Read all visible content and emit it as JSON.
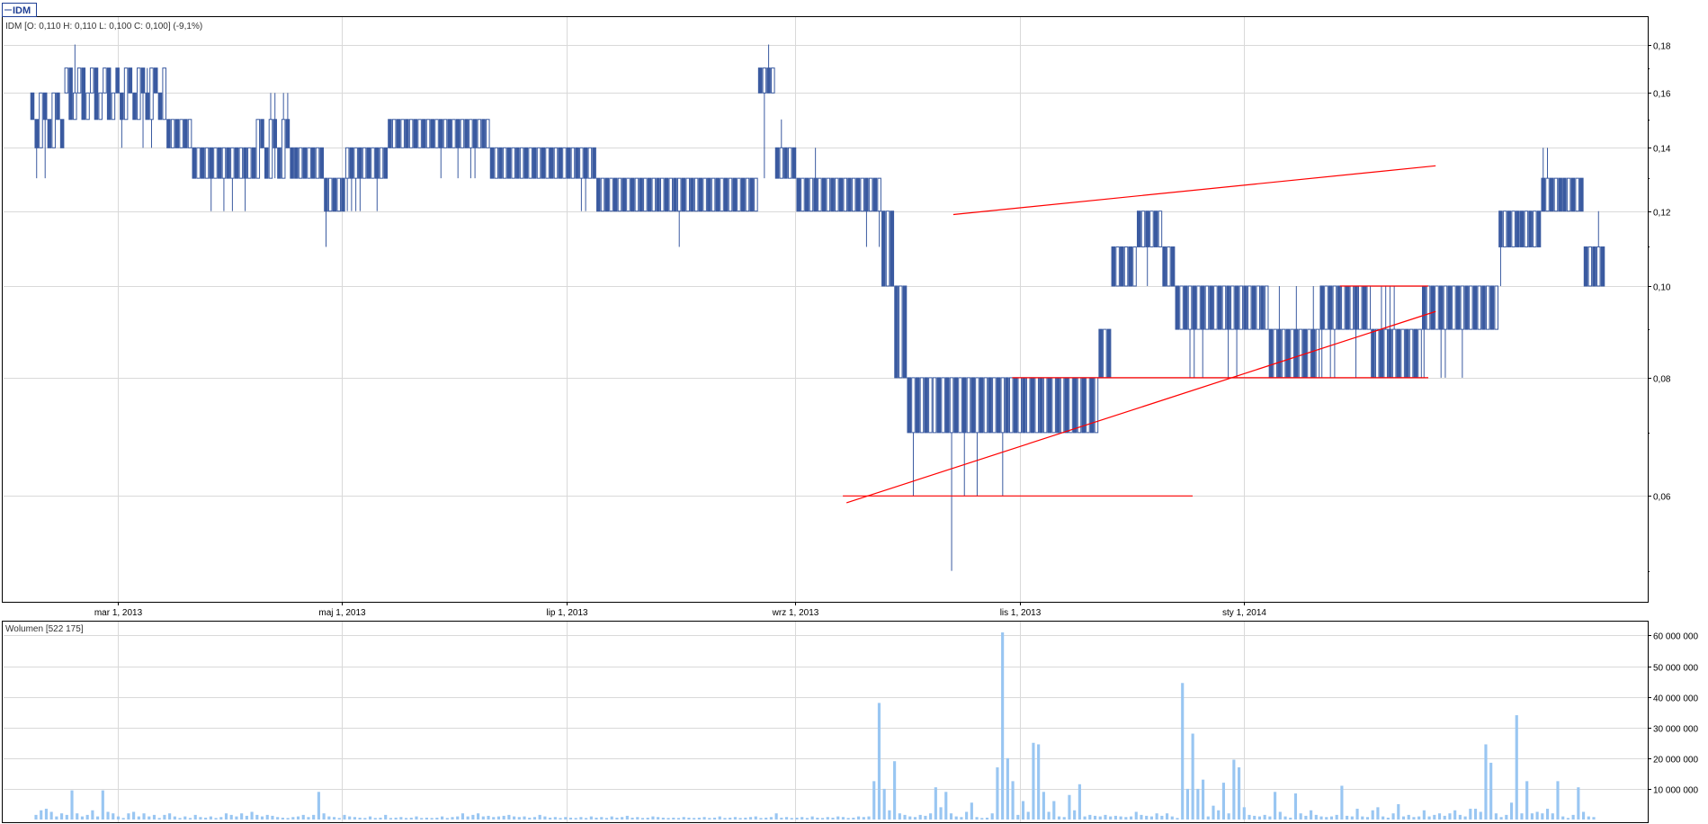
{
  "legend": {
    "symbol_label": "IDM"
  },
  "price_header": "IDM [O: 0,110  H: 0,110  L: 0,100  C: 0,100] (-9,1%)",
  "volume_header": "Wolumen [522 175]",
  "colors": {
    "bar": "#3a5aa0",
    "volume": "#99c6f2",
    "grid": "#d9d9d9",
    "frame": "#000000",
    "trendline": "#ff0000"
  },
  "chart_data": [
    {
      "type": "candlestick",
      "title": "",
      "x_tick_labels": [
        "mar 1, 2013",
        "maj 1, 2013",
        "lip 1, 2013",
        "wrz 1, 2013",
        "lis 1, 2013",
        "sty 1, 2014"
      ],
      "y_tick_labels": [
        "0,18",
        "0,16",
        "0,14",
        "0,12",
        "0,10",
        "0,08",
        "0,06"
      ],
      "y_scale": "log",
      "ylim": [
        0.0475,
        0.185
      ],
      "grid": true,
      "candle_stats": {
        "open": 0.11,
        "high": 0.11,
        "low": 0.1,
        "close": 0.1,
        "change": "-9,1%"
      },
      "segments": [
        {
          "bars": 8,
          "levels": [
            0.16,
            0.15,
            0.14
          ],
          "low_min": 0.13,
          "high_max": 0.16
        },
        {
          "bars": 12,
          "levels": [
            0.16,
            0.17,
            0.15
          ],
          "low_min": 0.15,
          "high_max": 0.18
        },
        {
          "bars": 12,
          "levels": [
            0.17,
            0.16,
            0.15
          ],
          "low_min": 0.14,
          "high_max": 0.17
        },
        {
          "bars": 6,
          "levels": [
            0.15,
            0.14
          ],
          "low_min": 0.14,
          "high_max": 0.15
        },
        {
          "bars": 14,
          "levels": [
            0.14,
            0.13
          ],
          "low_min": 0.12,
          "high_max": 0.14
        },
        {
          "bars": 10,
          "levels": [
            0.14,
            0.13,
            0.15
          ],
          "low_min": 0.13,
          "high_max": 0.16
        },
        {
          "bars": 7,
          "levels": [
            0.14,
            0.13
          ],
          "low_min": 0.13,
          "high_max": 0.14
        },
        {
          "bars": 5,
          "levels": [
            0.13,
            0.12
          ],
          "low_min": 0.11,
          "high_max": 0.13
        },
        {
          "bars": 10,
          "levels": [
            0.13,
            0.14
          ],
          "low_min": 0.12,
          "high_max": 0.14
        },
        {
          "bars": 14,
          "levels": [
            0.15,
            0.14
          ],
          "low_min": 0.13,
          "high_max": 0.15
        },
        {
          "bars": 10,
          "levels": [
            0.15,
            0.14
          ],
          "low_min": 0.13,
          "high_max": 0.15
        },
        {
          "bars": 14,
          "levels": [
            0.14,
            0.13
          ],
          "low_min": 0.13,
          "high_max": 0.14
        },
        {
          "bars": 11,
          "levels": [
            0.14,
            0.13
          ],
          "low_min": 0.12,
          "high_max": 0.14
        },
        {
          "bars": 14,
          "levels": [
            0.13,
            0.12
          ],
          "low_min": 0.12,
          "high_max": 0.13
        },
        {
          "bars": 12,
          "levels": [
            0.13,
            0.12
          ],
          "low_min": 0.11,
          "high_max": 0.13
        },
        {
          "bars": 12,
          "levels": [
            0.13,
            0.12
          ],
          "low_min": 0.12,
          "high_max": 0.13
        },
        {
          "bars": 4,
          "levels": [
            0.17,
            0.16
          ],
          "low_min": 0.13,
          "high_max": 0.18
        },
        {
          "bars": 5,
          "levels": [
            0.14,
            0.13
          ],
          "low_min": 0.13,
          "high_max": 0.15
        },
        {
          "bars": 12,
          "levels": [
            0.13,
            0.12
          ],
          "low_min": 0.12,
          "high_max": 0.14
        },
        {
          "bars": 8,
          "levels": [
            0.13,
            0.12
          ],
          "low_min": 0.11,
          "high_max": 0.13
        },
        {
          "bars": 3,
          "levels": [
            0.12,
            0.1
          ],
          "low_min": 0.1,
          "high_max": 0.12
        },
        {
          "bars": 3,
          "levels": [
            0.1,
            0.08
          ],
          "low_min": 0.08,
          "high_max": 0.1
        },
        {
          "bars": 6,
          "levels": [
            0.08,
            0.07
          ],
          "low_min": 0.06,
          "high_max": 0.08
        },
        {
          "bars": 5,
          "levels": [
            0.07,
            0.08
          ],
          "low_min": 0.05,
          "high_max": 0.08
        },
        {
          "bars": 12,
          "levels": [
            0.08,
            0.07
          ],
          "low_min": 0.06,
          "high_max": 0.08
        },
        {
          "bars": 16,
          "levels": [
            0.08,
            0.07
          ],
          "low_min": 0.07,
          "high_max": 0.08
        },
        {
          "bars": 6,
          "levels": [
            0.08,
            0.07
          ],
          "low_min": 0.07,
          "high_max": 0.08
        },
        {
          "bars": 3,
          "levels": [
            0.09,
            0.08
          ],
          "low_min": 0.08,
          "high_max": 0.09
        },
        {
          "bars": 6,
          "levels": [
            0.11,
            0.1
          ],
          "low_min": 0.09,
          "high_max": 0.11
        },
        {
          "bars": 6,
          "levels": [
            0.12,
            0.11
          ],
          "low_min": 0.1,
          "high_max": 0.12
        },
        {
          "bars": 3,
          "levels": [
            0.11,
            0.1
          ],
          "low_min": 0.1,
          "high_max": 0.11
        },
        {
          "bars": 10,
          "levels": [
            0.1,
            0.09
          ],
          "low_min": 0.08,
          "high_max": 0.1
        },
        {
          "bars": 12,
          "levels": [
            0.1,
            0.09
          ],
          "low_min": 0.08,
          "high_max": 0.1
        },
        {
          "bars": 12,
          "levels": [
            0.09,
            0.08
          ],
          "low_min": 0.08,
          "high_max": 0.1
        },
        {
          "bars": 12,
          "levels": [
            0.1,
            0.09
          ],
          "low_min": 0.08,
          "high_max": 0.1
        },
        {
          "bars": 12,
          "levels": [
            0.09,
            0.08
          ],
          "low_min": 0.08,
          "high_max": 0.1
        },
        {
          "bars": 12,
          "levels": [
            0.1,
            0.09
          ],
          "low_min": 0.08,
          "high_max": 0.1
        },
        {
          "bars": 6,
          "levels": [
            0.1,
            0.09
          ],
          "low_min": 0.08,
          "high_max": 0.1
        },
        {
          "bars": 5,
          "levels": [
            0.12,
            0.11
          ],
          "low_min": 0.1,
          "high_max": 0.12
        },
        {
          "bars": 5,
          "levels": [
            0.12,
            0.11
          ],
          "low_min": 0.11,
          "high_max": 0.12
        },
        {
          "bars": 5,
          "levels": [
            0.13,
            0.12
          ],
          "low_min": 0.12,
          "high_max": 0.14
        },
        {
          "bars": 5,
          "levels": [
            0.13,
            0.12
          ],
          "low_min": 0.12,
          "high_max": 0.13
        },
        {
          "bars": 5,
          "levels": [
            0.11,
            0.1
          ],
          "low_min": 0.1,
          "high_max": 0.12
        }
      ],
      "trendlines": [
        {
          "points": [
            [
              "2013-10-14",
              0.119
            ],
            [
              "2014-02-22",
              0.134
            ]
          ]
        },
        {
          "points": [
            [
              "2013-09-15",
              0.059
            ],
            [
              "2014-02-22",
              0.094
            ]
          ]
        },
        {
          "points": [
            [
              "2013-09-14",
              0.06
            ],
            [
              "2013-12-18",
              0.06
            ]
          ]
        },
        {
          "points": [
            [
              "2013-10-30",
              0.08
            ],
            [
              "2014-02-20",
              0.08
            ]
          ]
        },
        {
          "points": [
            [
              "2014-01-27",
              0.1
            ],
            [
              "2014-02-20",
              0.1
            ]
          ]
        }
      ]
    },
    {
      "type": "bar",
      "title": "",
      "y_tick_labels": [
        "60 000 000",
        "50 000 000",
        "40 000 000",
        "30 000 000",
        "20 000 000",
        "10 000 000"
      ],
      "ylim": [
        0,
        61000000
      ],
      "grid": true,
      "values": [
        1.5,
        3,
        3.5,
        2.5,
        1,
        2,
        1.5,
        9.5,
        2,
        1,
        1.5,
        3,
        1,
        9.5,
        2.5,
        2,
        1,
        0.5,
        2,
        2.5,
        1,
        2,
        1,
        1.5,
        0.5,
        1.5,
        2,
        1,
        0.5,
        1,
        0.5,
        1.5,
        0.8,
        0.6,
        1,
        0.5,
        0.8,
        2,
        1.5,
        1,
        2,
        1.2,
        2.5,
        1.5,
        1,
        1.5,
        1.2,
        0.8,
        0.6,
        0.5,
        0.8,
        1,
        1.5,
        0.8,
        1.5,
        9,
        2,
        1,
        0.8,
        0.5,
        1.5,
        1,
        0.8,
        0.6,
        0.5,
        1,
        0.5,
        0.6,
        1.5,
        0.5,
        0.6,
        0.8,
        0.5,
        0.6,
        1,
        0.5,
        0.6,
        0.5,
        0.6,
        1,
        0.5,
        0.8,
        1,
        2,
        1,
        1.5,
        2,
        1,
        1.2,
        0.8,
        1,
        1.2,
        1.5,
        1,
        0.8,
        1,
        0.6,
        0.8,
        1.5,
        1,
        0.6,
        0.8,
        0.5,
        0.8,
        0.6,
        0.5,
        0.8,
        0.5,
        1,
        0.6,
        0.8,
        0.5,
        1,
        0.6,
        0.8,
        1.2,
        0.6,
        0.8,
        0.5,
        0.6,
        1,
        0.8,
        0.6,
        0.5,
        0.6,
        0.5,
        0.8,
        0.6,
        0.5,
        0.6,
        0.8,
        0.5,
        0.6,
        1,
        0.5,
        0.6,
        0.8,
        0.5,
        0.6,
        0.8,
        1,
        0.5,
        0.6,
        0.8,
        2,
        0.6,
        0.8,
        0.5,
        0.6,
        0.8,
        0.5,
        1,
        0.6,
        0.5,
        0.8,
        0.6,
        1,
        0.8,
        0.5,
        0.6,
        1,
        0.8,
        1,
        12.5,
        38,
        10,
        3,
        19,
        2,
        1.5,
        1,
        0.8,
        1.5,
        1.2,
        2,
        10.5,
        4,
        9,
        2,
        1,
        0.8,
        2.5,
        5.5,
        0.8,
        0.5,
        0.6,
        2,
        17,
        61,
        20,
        12.5,
        1.5,
        6,
        2.5,
        25,
        24.5,
        9,
        2.5,
        6,
        1,
        0.8,
        8,
        3,
        11.5,
        1,
        1.5,
        1.2,
        1,
        1.5,
        1,
        1.2,
        1,
        0.8,
        1,
        2.5,
        1.5,
        1.2,
        1,
        2,
        1.2,
        2,
        1,
        0.5,
        44.5,
        10,
        28,
        10,
        13,
        1,
        4.5,
        3,
        12,
        2,
        19.5,
        17,
        4,
        1.5,
        1.2,
        1,
        1.5,
        1,
        9,
        2.5,
        1,
        0.6,
        8.5,
        2,
        1.2,
        3,
        1.5,
        1,
        0.8,
        1,
        1.5,
        11,
        1.2,
        1,
        3.5,
        1,
        0.8,
        3,
        4,
        1,
        0.6,
        2,
        5,
        1,
        1.5,
        0.8,
        1,
        3,
        1,
        1.5,
        2,
        1.2,
        2,
        3,
        1.5,
        1,
        3.5,
        3.5,
        2.5,
        24.5,
        18.5,
        2,
        0.8,
        1.5,
        5.5,
        34,
        2,
        12.5,
        2,
        2.5,
        2,
        3.5,
        2,
        12.5,
        1,
        0.5,
        1.5,
        10.5,
        2.5,
        1,
        0.8
      ]
    }
  ]
}
